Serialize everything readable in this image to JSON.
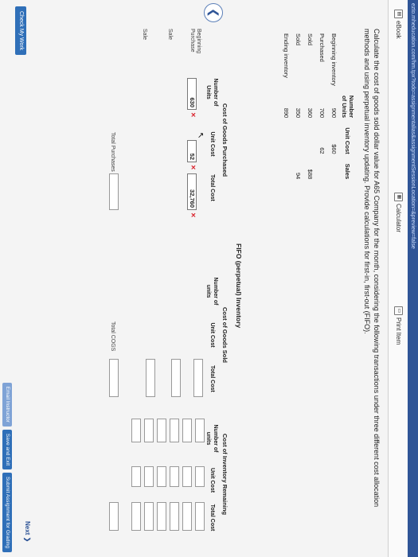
{
  "url": "ezto.mheducation.com/hm.tpx?todo=assignmentalias&assignmentSessionLocation=&preview=false",
  "toolbar": {
    "ebook": "eBook",
    "calculator": "Calculator",
    "print": "Print Item"
  },
  "question": "Calculate the cost of goods sold dollar value for A65 Company for the month, considering the following transactions under three different cost allocation methods and using perpetual inventory updating. Provide calculations for first-in, first-out (FIFO).",
  "transactions": {
    "headers": {
      "units_top": "Number",
      "units_bottom": "of Units",
      "unit_cost": "Unit Cost",
      "sales": "Sales"
    },
    "rows": [
      {
        "label": "Beginning inventory",
        "units": "900",
        "unit_cost": "$60",
        "sales": ""
      },
      {
        "label": "Purchased",
        "units": "700",
        "unit_cost": "62",
        "sales": ""
      },
      {
        "label": "Sold",
        "units": "360",
        "unit_cost": "",
        "sales": "$88"
      },
      {
        "label": "Sold",
        "units": "350",
        "unit_cost": "",
        "sales": "94"
      },
      {
        "label": "Ending inventory",
        "units": "890",
        "unit_cost": "",
        "sales": ""
      }
    ]
  },
  "fifo": {
    "title": "FIFO (perpetual) Inventory",
    "groups": {
      "purchased": "Cost of Goods Purchased",
      "sold": "Cost of Goods Sold",
      "remaining": "Cost of Inventory Remaining"
    },
    "col_headers": {
      "num_units": "Number of Units",
      "num_units_lc": "Number of units",
      "unit_cost": "Unit Cost",
      "total_cost": "Total Cost"
    },
    "rows": {
      "beginning": "Beginning",
      "purchase": "Purchase",
      "sale1": "Sale",
      "sale2": "Sale"
    },
    "entries": {
      "units": "630",
      "unit_cost": "52",
      "total_cost": "32,760"
    },
    "total_purchases": "Total Purchases",
    "total_cogs": "Total COGS"
  },
  "buttons": {
    "check": "Check My Work",
    "next": "Next",
    "email": "Email Instructor",
    "save": "Save and Exit",
    "submit": "Submit Assignment for Grading"
  }
}
